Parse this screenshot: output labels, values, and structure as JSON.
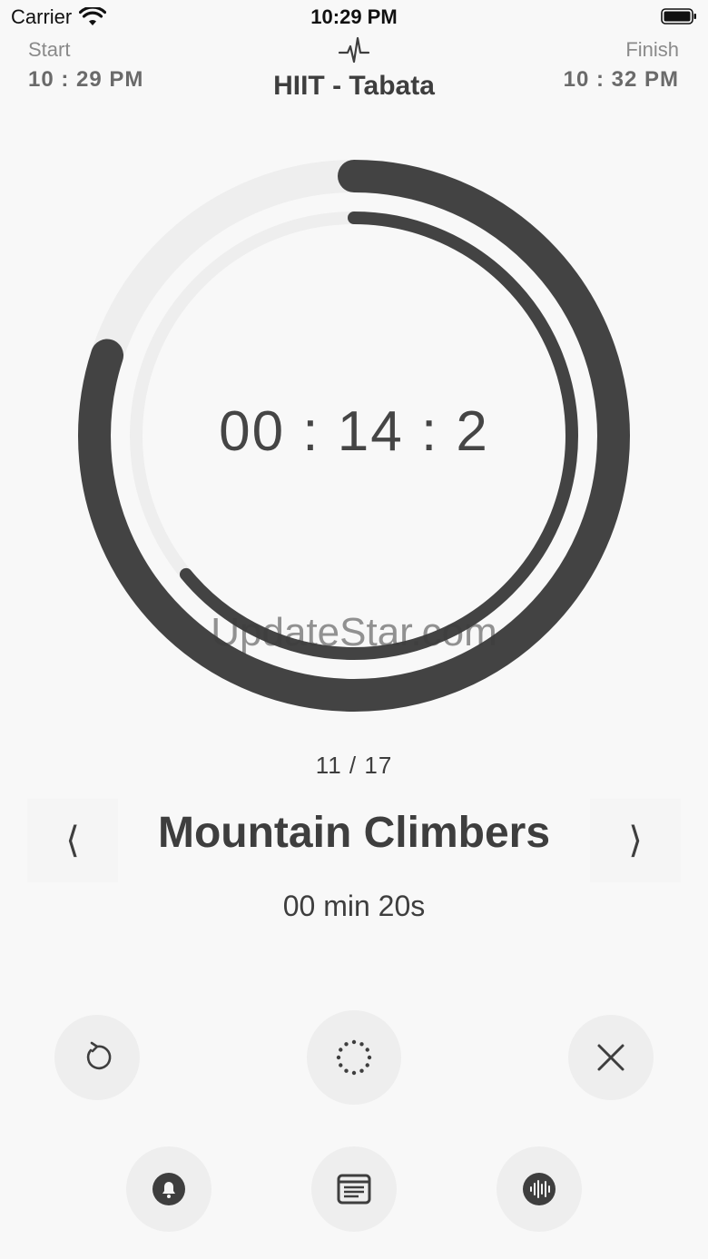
{
  "status_bar": {
    "carrier": "Carrier",
    "time": "10:29 PM"
  },
  "header": {
    "start_label": "Start",
    "start_time": "10 : 29 PM",
    "title": "HIIT - Tabata",
    "finish_label": "Finish",
    "finish_time": "10 : 32 PM"
  },
  "timer": {
    "display": "00 : 14 : 2",
    "outer_progress": 0.8,
    "inner_progress": 0.64
  },
  "watermark": "UpdateStar.com",
  "exercise": {
    "counter": "11 / 17",
    "name": "Mountain Climbers",
    "duration": "00 min 20s",
    "prev_symbol": "⟨",
    "next_symbol": "⟩"
  },
  "controls": {
    "row1": [
      {
        "name": "restart-button",
        "icon": "restart-icon"
      },
      {
        "name": "pause-button",
        "icon": "dotted-circle-icon"
      },
      {
        "name": "close-button",
        "icon": "close-icon"
      }
    ],
    "row2": [
      {
        "name": "bell-button",
        "icon": "bell-icon"
      },
      {
        "name": "notes-button",
        "icon": "notes-icon"
      },
      {
        "name": "sound-button",
        "icon": "sound-wave-icon"
      }
    ]
  },
  "colors": {
    "ring_dark": "#434343",
    "ring_track": "#eeeeee",
    "background": "#f8f8f8"
  }
}
